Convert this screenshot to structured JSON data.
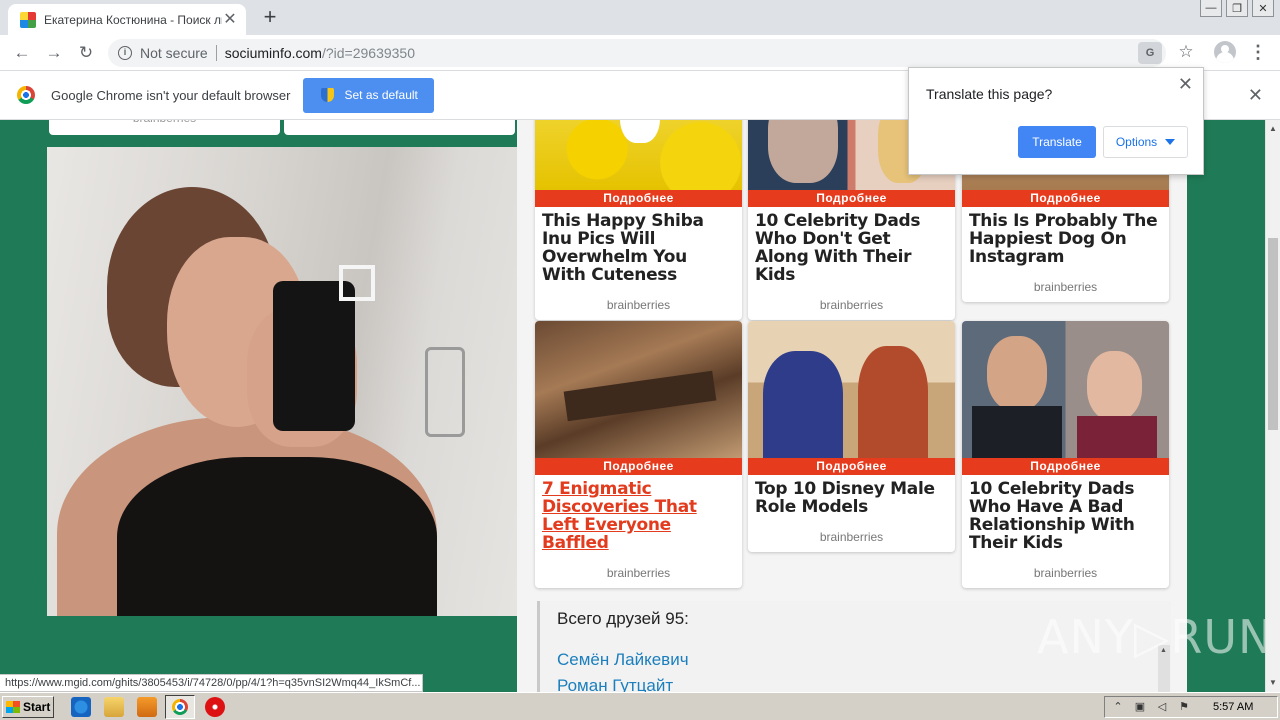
{
  "browser": {
    "tab_title": "Екатерина Костюнина - Поиск лю...",
    "tab_close": "✕",
    "new_tab": "+",
    "url_security": "Not secure",
    "url_host": "sociuminfo.com",
    "url_path": "/?id=29639350",
    "translate_icon_glyph": "G",
    "star_glyph": "☆",
    "menu_glyph": "⋮",
    "back_glyph": "←",
    "forward_glyph": "→",
    "reload_glyph": "↻",
    "minimize_glyph": "—",
    "restore_glyph": "❐",
    "close_glyph": "✕"
  },
  "infobar": {
    "message": "Google Chrome isn't your default browser",
    "button": "Set as default",
    "close": "✕"
  },
  "translate_popup": {
    "question": "Translate this page?",
    "translate_button": "Translate",
    "options_button": "Options",
    "close": "✕"
  },
  "partial_cards": [
    "brainberries",
    ""
  ],
  "cards": [
    {
      "ribbon": "Подробнее",
      "headline": "This Happy Shiba Inu Pics Will Overwhelm You With Cuteness",
      "source": "brainberries",
      "linked": false,
      "image": "shiba-flowers"
    },
    {
      "ribbon": "Подробнее",
      "headline": "10 Celebrity Dads Who Don't Get Along With Their Kids",
      "source": "brainberries",
      "linked": false,
      "image": "celebrity-dads"
    },
    {
      "ribbon": "Подробнее",
      "headline": "This Is Probably The Happiest Dog On Instagram",
      "source": "brainberries",
      "linked": false,
      "image": "happy-dog"
    },
    {
      "ribbon": "Подробнее",
      "headline": "7 Enigmatic Discoveries That Left Everyone Baffled",
      "source": "brainberries",
      "linked": true,
      "image": "excavation"
    },
    {
      "ribbon": "Подробнее",
      "headline": "Top 10 Disney Male Role Models",
      "source": "brainberries",
      "linked": false,
      "image": "aladdin"
    },
    {
      "ribbon": "Подробнее",
      "headline": "10 Celebrity Dads Who Have A Bad Relationship With Their Kids",
      "source": "brainberries",
      "linked": false,
      "image": "dad-daughter"
    }
  ],
  "friends": {
    "heading": "Всего друзей 95:",
    "list": [
      "Семён Лайкевич",
      "Роман Гутцайт"
    ]
  },
  "status_bar_url": "https://www.mgid.com/ghits/3805453/i/74728/0/pp/4/1?h=q35vnSI2Wmq44_IkSmCf...",
  "watermark": "ANY▷RUN",
  "taskbar": {
    "start": "Start",
    "time": "5:57 AM"
  },
  "colors": {
    "page_background": "#1f7b57",
    "ribbon": "#e63b1d",
    "link": "#1b7fbd",
    "translate_button": "#4285f4"
  }
}
